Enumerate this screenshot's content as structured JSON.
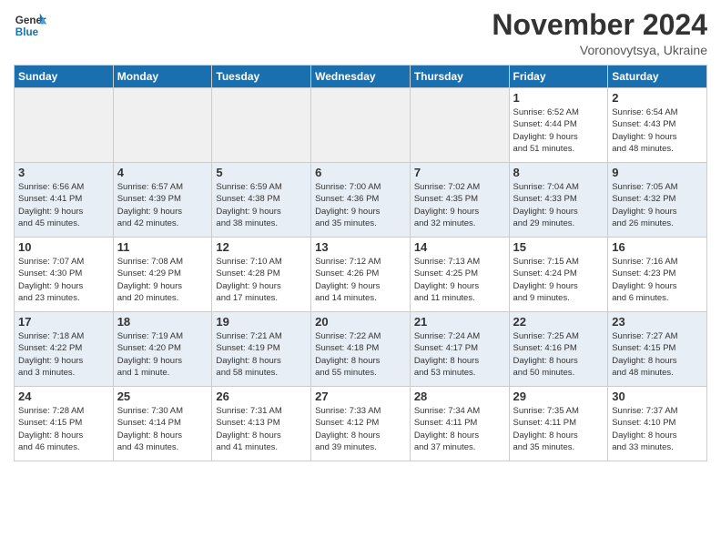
{
  "header": {
    "logo_line1": "General",
    "logo_line2": "Blue",
    "month": "November 2024",
    "location": "Voronovytsya, Ukraine"
  },
  "weekdays": [
    "Sunday",
    "Monday",
    "Tuesday",
    "Wednesday",
    "Thursday",
    "Friday",
    "Saturday"
  ],
  "weeks": [
    [
      {
        "day": "",
        "detail": ""
      },
      {
        "day": "",
        "detail": ""
      },
      {
        "day": "",
        "detail": ""
      },
      {
        "day": "",
        "detail": ""
      },
      {
        "day": "",
        "detail": ""
      },
      {
        "day": "1",
        "detail": "Sunrise: 6:52 AM\nSunset: 4:44 PM\nDaylight: 9 hours\nand 51 minutes."
      },
      {
        "day": "2",
        "detail": "Sunrise: 6:54 AM\nSunset: 4:43 PM\nDaylight: 9 hours\nand 48 minutes."
      }
    ],
    [
      {
        "day": "3",
        "detail": "Sunrise: 6:56 AM\nSunset: 4:41 PM\nDaylight: 9 hours\nand 45 minutes."
      },
      {
        "day": "4",
        "detail": "Sunrise: 6:57 AM\nSunset: 4:39 PM\nDaylight: 9 hours\nand 42 minutes."
      },
      {
        "day": "5",
        "detail": "Sunrise: 6:59 AM\nSunset: 4:38 PM\nDaylight: 9 hours\nand 38 minutes."
      },
      {
        "day": "6",
        "detail": "Sunrise: 7:00 AM\nSunset: 4:36 PM\nDaylight: 9 hours\nand 35 minutes."
      },
      {
        "day": "7",
        "detail": "Sunrise: 7:02 AM\nSunset: 4:35 PM\nDaylight: 9 hours\nand 32 minutes."
      },
      {
        "day": "8",
        "detail": "Sunrise: 7:04 AM\nSunset: 4:33 PM\nDaylight: 9 hours\nand 29 minutes."
      },
      {
        "day": "9",
        "detail": "Sunrise: 7:05 AM\nSunset: 4:32 PM\nDaylight: 9 hours\nand 26 minutes."
      }
    ],
    [
      {
        "day": "10",
        "detail": "Sunrise: 7:07 AM\nSunset: 4:30 PM\nDaylight: 9 hours\nand 23 minutes."
      },
      {
        "day": "11",
        "detail": "Sunrise: 7:08 AM\nSunset: 4:29 PM\nDaylight: 9 hours\nand 20 minutes."
      },
      {
        "day": "12",
        "detail": "Sunrise: 7:10 AM\nSunset: 4:28 PM\nDaylight: 9 hours\nand 17 minutes."
      },
      {
        "day": "13",
        "detail": "Sunrise: 7:12 AM\nSunset: 4:26 PM\nDaylight: 9 hours\nand 14 minutes."
      },
      {
        "day": "14",
        "detail": "Sunrise: 7:13 AM\nSunset: 4:25 PM\nDaylight: 9 hours\nand 11 minutes."
      },
      {
        "day": "15",
        "detail": "Sunrise: 7:15 AM\nSunset: 4:24 PM\nDaylight: 9 hours\nand 9 minutes."
      },
      {
        "day": "16",
        "detail": "Sunrise: 7:16 AM\nSunset: 4:23 PM\nDaylight: 9 hours\nand 6 minutes."
      }
    ],
    [
      {
        "day": "17",
        "detail": "Sunrise: 7:18 AM\nSunset: 4:22 PM\nDaylight: 9 hours\nand 3 minutes."
      },
      {
        "day": "18",
        "detail": "Sunrise: 7:19 AM\nSunset: 4:20 PM\nDaylight: 9 hours\nand 1 minute."
      },
      {
        "day": "19",
        "detail": "Sunrise: 7:21 AM\nSunset: 4:19 PM\nDaylight: 8 hours\nand 58 minutes."
      },
      {
        "day": "20",
        "detail": "Sunrise: 7:22 AM\nSunset: 4:18 PM\nDaylight: 8 hours\nand 55 minutes."
      },
      {
        "day": "21",
        "detail": "Sunrise: 7:24 AM\nSunset: 4:17 PM\nDaylight: 8 hours\nand 53 minutes."
      },
      {
        "day": "22",
        "detail": "Sunrise: 7:25 AM\nSunset: 4:16 PM\nDaylight: 8 hours\nand 50 minutes."
      },
      {
        "day": "23",
        "detail": "Sunrise: 7:27 AM\nSunset: 4:15 PM\nDaylight: 8 hours\nand 48 minutes."
      }
    ],
    [
      {
        "day": "24",
        "detail": "Sunrise: 7:28 AM\nSunset: 4:15 PM\nDaylight: 8 hours\nand 46 minutes."
      },
      {
        "day": "25",
        "detail": "Sunrise: 7:30 AM\nSunset: 4:14 PM\nDaylight: 8 hours\nand 43 minutes."
      },
      {
        "day": "26",
        "detail": "Sunrise: 7:31 AM\nSunset: 4:13 PM\nDaylight: 8 hours\nand 41 minutes."
      },
      {
        "day": "27",
        "detail": "Sunrise: 7:33 AM\nSunset: 4:12 PM\nDaylight: 8 hours\nand 39 minutes."
      },
      {
        "day": "28",
        "detail": "Sunrise: 7:34 AM\nSunset: 4:11 PM\nDaylight: 8 hours\nand 37 minutes."
      },
      {
        "day": "29",
        "detail": "Sunrise: 7:35 AM\nSunset: 4:11 PM\nDaylight: 8 hours\nand 35 minutes."
      },
      {
        "day": "30",
        "detail": "Sunrise: 7:37 AM\nSunset: 4:10 PM\nDaylight: 8 hours\nand 33 minutes."
      }
    ]
  ]
}
